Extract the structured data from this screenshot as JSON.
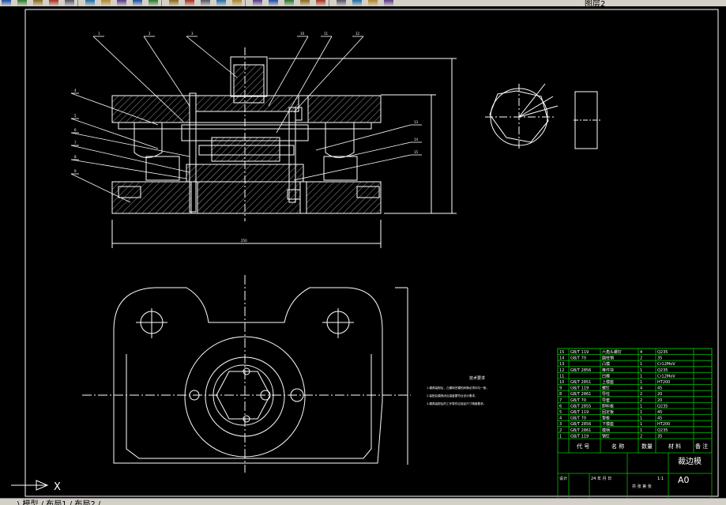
{
  "toolbar": {
    "layer_label": "图层2",
    "icons": [
      "new-icon",
      "save-icon",
      "print-icon",
      "preview-icon",
      "publish-icon",
      "cut-icon",
      "copy-icon",
      "paste-icon",
      "match-icon",
      "undo-icon",
      "redo-icon",
      "pan-icon",
      "zoom-realtime-icon",
      "zoom-window-icon",
      "zoom-previous-icon",
      "properties-icon",
      "design-center-icon",
      "tool-palette-icon",
      "sheet-set-icon",
      "markup-icon",
      "calculator-icon",
      "help-icon",
      "layer-manager-icon",
      "layer-state-icon"
    ]
  },
  "status": {
    "tabs_text": "\\ 模型 / 布局1 / 布局2 /",
    "axis_x": "X"
  },
  "drawing": {
    "notes_title": "技术要求",
    "notes_lines": [
      "1.模具装配后，凸模和凹模的间隙必须均匀一致，",
      "2.装配后模具闭合高度要符合设计要求，",
      "3.模具装配后的工作零件应保证尺寸精度要求。"
    ],
    "dimension_label": "250",
    "balloons": [
      "1",
      "2",
      "3",
      "4",
      "5",
      "6",
      "7",
      "8",
      "9",
      "10",
      "11",
      "12",
      "13",
      "14",
      "15"
    ]
  },
  "bom": {
    "rows": [
      [
        "15",
        "GB/T 119",
        "六角头螺钉",
        "4",
        "Q235",
        ""
      ],
      [
        "14",
        "GB/T 70",
        "圆柱销",
        "2",
        "35",
        ""
      ],
      [
        "13",
        "",
        "凸模",
        "1",
        "Cr12MoV",
        ""
      ],
      [
        "12",
        "GB/T 2856",
        "推件块",
        "1",
        "Q235",
        ""
      ],
      [
        "11",
        "",
        "凹模",
        "1",
        "Cr12MoV",
        ""
      ],
      [
        "10",
        "GB/T 2851",
        "上模座",
        "1",
        "HT200",
        ""
      ],
      [
        "9",
        "GB/T 119",
        "螺钉",
        "4",
        "45",
        ""
      ],
      [
        "8",
        "GB/T 2861",
        "导柱",
        "2",
        "20",
        ""
      ],
      [
        "7",
        "GB/T 70",
        "导套",
        "2",
        "20",
        ""
      ],
      [
        "6",
        "GB/T 2855",
        "卸料板",
        "1",
        "Q235",
        ""
      ],
      [
        "5",
        "GB/T 119",
        "固定板",
        "1",
        "45",
        ""
      ],
      [
        "4",
        "GB/T 70",
        "垫板",
        "1",
        "45",
        ""
      ],
      [
        "3",
        "GB/T 2856",
        "下模座",
        "1",
        "HT200",
        ""
      ],
      [
        "2",
        "GB/T 2861",
        "模柄",
        "1",
        "Q235",
        ""
      ],
      [
        "1",
        "GB/T 119",
        "销钉",
        "2",
        "35",
        ""
      ]
    ],
    "header": {
      "code": "代 号",
      "name": "名 称",
      "qty": "数量",
      "material": "材 料",
      "remark": "备 注"
    },
    "title": "裁边模",
    "sheet": "A0",
    "designer": "设计",
    "date": "24 年 月 日",
    "scale": "1:1",
    "school": "共 张 第 张"
  }
}
